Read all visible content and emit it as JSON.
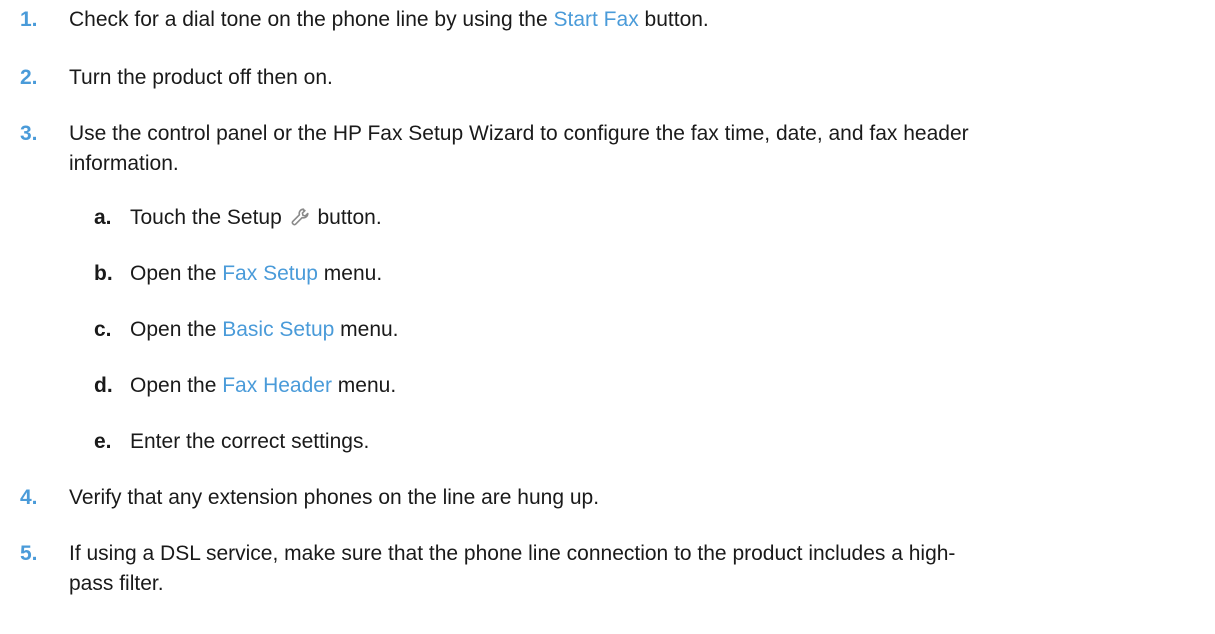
{
  "steps": [
    {
      "number": "1.",
      "pre": "Check for a dial tone on the phone line by using the ",
      "link": "Start Fax",
      "post": " button."
    },
    {
      "number": "2.",
      "text": "Turn the product off then on."
    },
    {
      "number": "3.",
      "line1": "Use the control panel or the HP Fax Setup Wizard to configure the fax time, date, and fax header",
      "line2": "information.",
      "substeps": [
        {
          "letter": "a.",
          "pre": "Touch the Setup ",
          "post": " button.",
          "icon": "wrench-icon"
        },
        {
          "letter": "b.",
          "pre": "Open the ",
          "link": "Fax Setup",
          "post": " menu."
        },
        {
          "letter": "c.",
          "pre": "Open the ",
          "link": "Basic Setup",
          "post": " menu."
        },
        {
          "letter": "d.",
          "pre": "Open the ",
          "link": "Fax Header",
          "post": " menu."
        },
        {
          "letter": "e.",
          "text": "Enter the correct settings."
        }
      ]
    },
    {
      "number": "4.",
      "text": "Verify that any extension phones on the line are hung up."
    },
    {
      "number": "5.",
      "line1": "If using a DSL service, make sure that the phone line connection to the product includes a high-",
      "line2": "pass filter."
    }
  ],
  "colors": {
    "accent": "#4a9bd9",
    "text": "#1a1a1a"
  }
}
